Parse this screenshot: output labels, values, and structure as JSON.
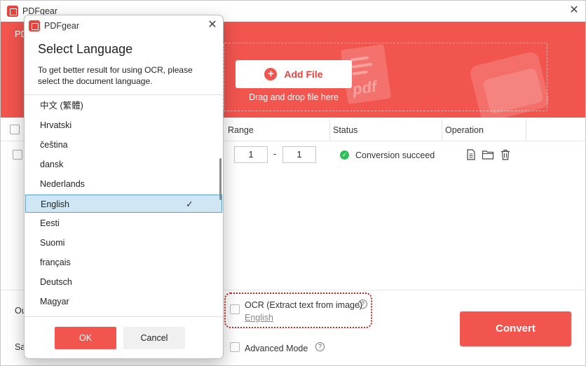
{
  "app": {
    "title": "PDFgear",
    "close_glyph": "✕",
    "logo_icon": "pdfgear-logo-icon"
  },
  "banner": {
    "left_text": "PD",
    "add_file_label": "Add File",
    "add_icon": "plus-icon",
    "drag_text": "Drag and drop file here",
    "decoration_text": "pdf",
    "color": "#f2544e"
  },
  "table": {
    "headers": {
      "range": "Range",
      "status": "Status",
      "operation": "Operation"
    },
    "row": {
      "range_from": "1",
      "range_dash": "-",
      "range_to": "1",
      "status": "Conversion succeed",
      "status_color": "#2ebf5a"
    },
    "operation_icons": [
      "document-icon",
      "folder-icon",
      "trash-icon"
    ]
  },
  "bottom": {
    "label_output": "Ou",
    "label_save": "Sa",
    "ocr_label": "OCR (Extract text from image)",
    "ocr_language": "English",
    "advanced_label": "Advanced Mode",
    "help_glyph": "?",
    "convert_label": "Convert"
  },
  "dialog": {
    "title": "PDFgear",
    "close_glyph": "✕",
    "heading": "Select Language",
    "description": "To get better result for using OCR, please select the document language.",
    "languages": [
      "中文 (繁體)",
      "Hrvatski",
      "čeština",
      "dansk",
      "Nederlands",
      "English",
      "Eesti",
      "Suomi",
      "français",
      "Deutsch",
      "Magyar"
    ],
    "selected_language": "English",
    "check_glyph": "✓",
    "ok_label": "OK",
    "cancel_label": "Cancel"
  }
}
